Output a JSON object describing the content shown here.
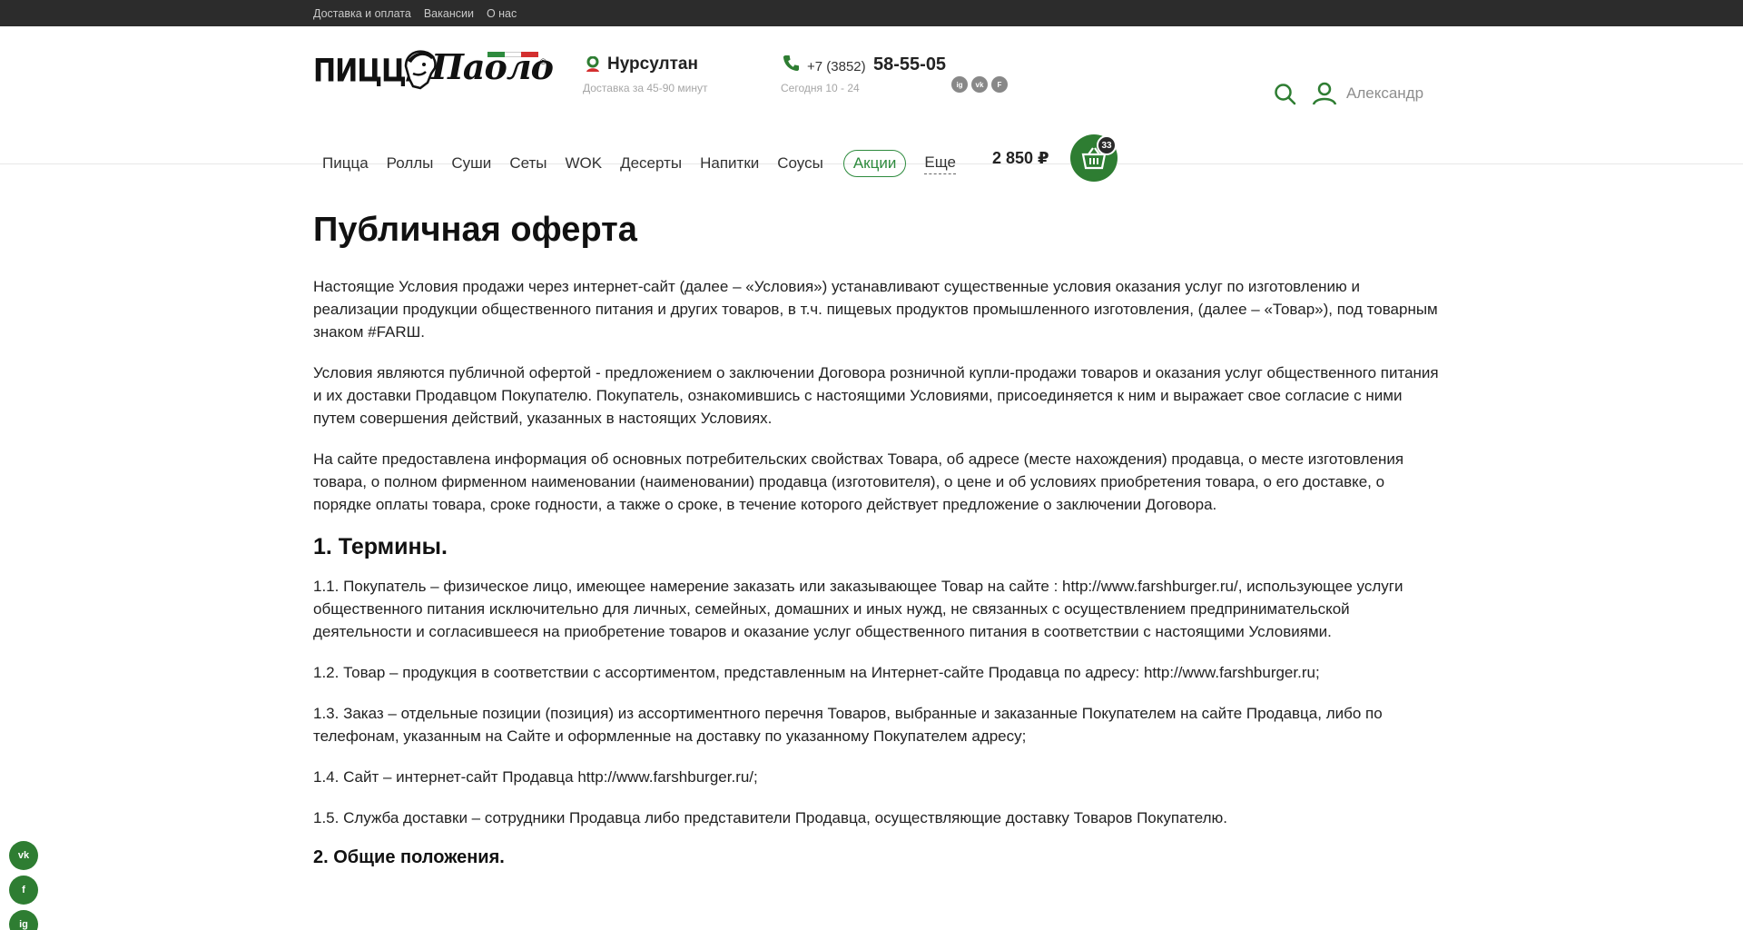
{
  "topbar": {
    "links": [
      "Доставка и оплата",
      "Вакансии",
      "О нас"
    ]
  },
  "brand": {
    "left": "ПИЦЦА",
    "right": "Паоло",
    "reg": "®"
  },
  "city": {
    "name": "Нурсултан",
    "delivery": "Доставка за 45-90 минут"
  },
  "phone": {
    "code": "+7 (3852)",
    "number": "58-55-05",
    "hours": "Сегодня 10 - 24"
  },
  "social_top": [
    "instagram-icon",
    "vk-icon",
    "foursquare-icon"
  ],
  "user": {
    "name": "Александр"
  },
  "nav": [
    "Пицца",
    "Роллы",
    "Суши",
    "Сеты",
    "WOK",
    "Десерты",
    "Напитки",
    "Соусы"
  ],
  "nav_promo": "Акции",
  "nav_more": "Еще",
  "cart": {
    "sum": "2 850 ₽",
    "count": "33"
  },
  "page": {
    "title": "Публичная оферта",
    "intro": [
      "Настоящие Условия продажи через интернет-сайт (далее – «Условия») устанавливают существенные условия оказания услуг по изготовлению и реализации продукции общественного питания и других товаров, в т.ч. пищевых продуктов промышленного изготовления, (далее – «Товар»), под товарным знаком #FARШ.",
      "Условия являются публичной офертой - предложением о заключении Договора розничной купли-продажи товаров и оказания услуг общественного питания и их доставки Продавцом Покупателю. Покупатель, ознакомившись с настоящими Условиями, присоединяется к ним и выражает свое согласие с ними путем совершения действий, указанных в настоящих Условиях.",
      "На сайте предоставлена информация об основных потребительских свойствах Товара, об адресе (месте нахождения) продавца, о месте изготовления товара, о полном фирменном наименовании (наименовании) продавца (изготовителя), о цене и об условиях приобретения товара, о его доставке, о порядке оплаты товара, сроке годности, а также о сроке, в течение которого действует предложение о заключении Договора."
    ],
    "section1_title": "1. Термины.",
    "section1": [
      "1.1. Покупатель – физическое лицо, имеющее намерение заказать или заказывающее Товар на сайте : http://www.farshburger.ru/, использующее услуги общественного питания исключительно для личных, семейных, домашних и иных нужд, не связанных с осуществлением предпринимательской деятельности и согласившееся на приобретение товаров и оказание услуг общественного питания в соответствии с настоящими Условиями.",
      "1.2. Товар – продукция в соответствии с ассортиментом, представленным на Интернет-сайте Продавца по адресу: http://www.farshburger.ru;",
      "1.3. Заказ – отдельные позиции (позиция) из ассортиментного перечня Товаров, выбранные и заказанные Покупателем на сайте Продавца, либо по телефонам, указанным на Сайте и оформленные на доставку по указанному Покупателем адресу;",
      "1.4. Сайт – интернет-сайт Продавца http://www.farshburger.ru/;",
      "1.5. Служба доставки – сотрудники Продавца либо представители Продавца, осуществляющие доставку Товаров Покупателю."
    ],
    "section2_title": "2. Общие положения."
  },
  "side_socials": [
    {
      "icon": "vk-icon",
      "label": "vk"
    },
    {
      "icon": "facebook-icon",
      "label": "f"
    },
    {
      "icon": "instagram-icon",
      "label": "ig"
    }
  ],
  "colors": {
    "accent": "#2e7d32",
    "topbar": "#2c2c2c",
    "muted": "#a6a6a6"
  }
}
